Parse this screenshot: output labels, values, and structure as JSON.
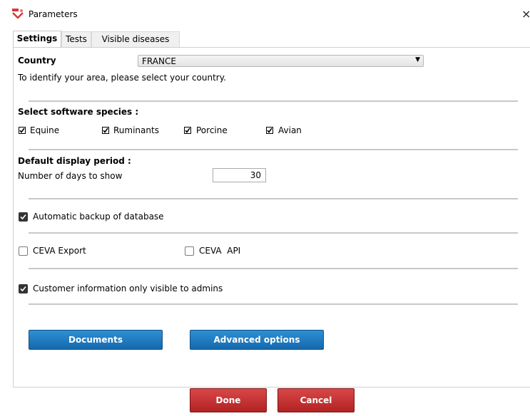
{
  "window": {
    "title": "Parameters",
    "close_glyph": "×"
  },
  "tabs": [
    {
      "label": "Settings",
      "active": true
    },
    {
      "label": "Tests",
      "active": false
    },
    {
      "label": "Visible diseases",
      "active": false
    }
  ],
  "country": {
    "label": "Country",
    "selected": "FRANCE",
    "hint": "To identify your area, please select your country."
  },
  "species": {
    "heading": "Select software species :",
    "items": [
      {
        "label": "Equine",
        "checked": true
      },
      {
        "label": "Ruminants",
        "checked": true
      },
      {
        "label": "Porcine",
        "checked": true
      },
      {
        "label": "Avian",
        "checked": true
      }
    ]
  },
  "display_period": {
    "heading": "Default display period :",
    "days_label": "Number of days to show",
    "days_value": "30"
  },
  "options": {
    "auto_backup": {
      "label": "Automatic backup of database",
      "checked": true
    },
    "ceva_export": {
      "label": "CEVA Export",
      "checked": false
    },
    "ceva_api": {
      "label": "CEVA  API",
      "checked": false
    },
    "customer_admin_only": {
      "label": "Customer information only visible to admins",
      "checked": true
    }
  },
  "buttons": {
    "documents": "Documents",
    "advanced": "Advanced options",
    "done": "Done",
    "cancel": "Cancel"
  },
  "colors": {
    "blue_button": "#1f7bc2",
    "red_button": "#c0302f"
  }
}
